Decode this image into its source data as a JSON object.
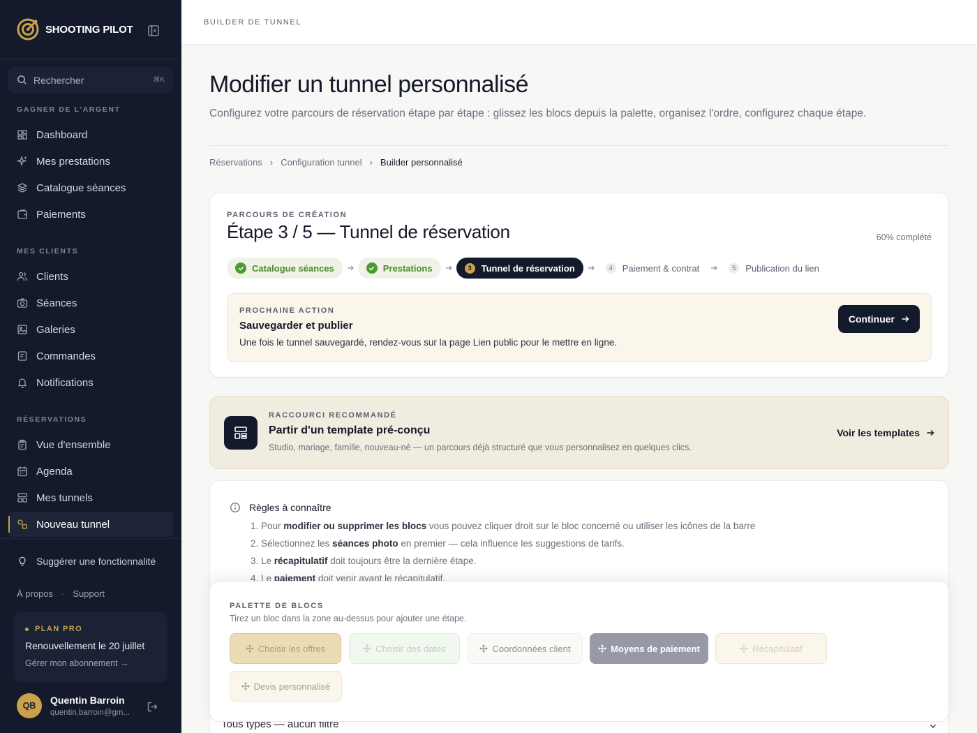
{
  "sidebar": {
    "brand": "SHOOTING PILOT",
    "search": {
      "placeholder": "Rechercher",
      "shortcut": "⌘K"
    },
    "sections": [
      {
        "title": "GAGNER DE L'ARGENT",
        "items": [
          {
            "label": "Dashboard",
            "icon": "dashboard-icon"
          },
          {
            "label": "Mes prestations",
            "icon": "sparkle-icon"
          },
          {
            "label": "Catalogue séances",
            "icon": "layers-icon"
          },
          {
            "label": "Paiements",
            "icon": "wallet-icon"
          }
        ]
      },
      {
        "title": "MES CLIENTS",
        "items": [
          {
            "label": "Clients",
            "icon": "users-icon"
          },
          {
            "label": "Séances",
            "icon": "camera-icon"
          },
          {
            "label": "Galeries",
            "icon": "image-icon"
          },
          {
            "label": "Commandes",
            "icon": "receipt-icon"
          },
          {
            "label": "Notifications",
            "icon": "bell-icon"
          }
        ]
      },
      {
        "title": "RÉSERVATIONS",
        "items": [
          {
            "label": "Vue d'ensemble",
            "icon": "clipboard-icon"
          },
          {
            "label": "Agenda",
            "icon": "calendar-icon"
          },
          {
            "label": "Mes tunnels",
            "icon": "layout-icon"
          },
          {
            "label": "Nouveau tunnel",
            "icon": "shapes-icon",
            "active": true
          }
        ]
      }
    ],
    "suggest": "Suggérer une fonctionnalité",
    "links": {
      "about": "À propos",
      "support": "Support"
    },
    "plan": {
      "title": "PLAN PRO",
      "renewal": "Renouvellement le 20 juillet",
      "manage": "Gérer mon abonnement →"
    },
    "user": {
      "initials": "QB",
      "name": "Quentin Barroin",
      "email": "quentin.barroin@gm..."
    }
  },
  "topbar": {
    "title": "BUILDER DE TUNNEL"
  },
  "page": {
    "title": "Modifier un tunnel personnalisé",
    "subtitle": "Configurez votre parcours de réservation étape par étape : glissez les blocs depuis la palette, organisez l'ordre, configurez chaque étape.",
    "breadcrumb": [
      "Réservations",
      "Configuration tunnel",
      "Builder personnalisé"
    ]
  },
  "progress": {
    "eyebrow": "PARCOURS DE CRÉATION",
    "title": "Étape 3 / 5 — Tunnel de réservation",
    "percent_label": "60% complété",
    "percent": 60,
    "steps": [
      {
        "label": "Catalogue séances",
        "status": "done"
      },
      {
        "label": "Prestations",
        "status": "done"
      },
      {
        "num": "3",
        "label": "Tunnel de réservation",
        "status": "current"
      },
      {
        "num": "4",
        "label": "Paiement & contrat",
        "status": "todo"
      },
      {
        "num": "5",
        "label": "Publication du lien",
        "status": "todo"
      }
    ],
    "next": {
      "eyebrow": "PROCHAINE ACTION",
      "title": "Sauvegarder et publier",
      "desc": "Une fois le tunnel sauvegardé, rendez-vous sur la page Lien public pour le mettre en ligne.",
      "button": "Continuer"
    }
  },
  "shortcut": {
    "eyebrow": "RACCOURCI RECOMMANDÉ",
    "title": "Partir d'un template pré-conçu",
    "desc": "Studio, mariage, famille, nouveau-né — un parcours déjà structuré que vous personnalisez en quelques clics.",
    "link": "Voir les templates"
  },
  "rules": {
    "title": "Règles à connaître",
    "items": [
      {
        "n": "1. ",
        "a": "Pour ",
        "b": "modifier ou supprimer les blocs",
        "c": " vous pouvez cliquer droit sur le bloc concerné ou utiliser les icônes de la barre"
      },
      {
        "n": "2. ",
        "a": "Sélectionnez les ",
        "b": "séances photo",
        "c": " en premier — cela influence les suggestions de tarifs."
      },
      {
        "n": "3. ",
        "a": "Le ",
        "b": "récapitulatif",
        "c": " doit toujours être la dernière étape."
      },
      {
        "n": "4. ",
        "a": "Le ",
        "b": "paiement",
        "c": " doit venir avant le récapitulatif."
      }
    ],
    "filter": "Tous types — aucun filtre"
  },
  "palette": {
    "eyebrow": "PALETTE DE BLOCS",
    "subtitle": "Tirez un bloc dans la zone au-dessus pour ajouter une étape.",
    "blocks": [
      "Choisir les offres",
      "Choisir des dates",
      "Coordonnées client",
      "Moyens de paiement",
      "Récapitulatif",
      "Devis personnalisé"
    ]
  }
}
